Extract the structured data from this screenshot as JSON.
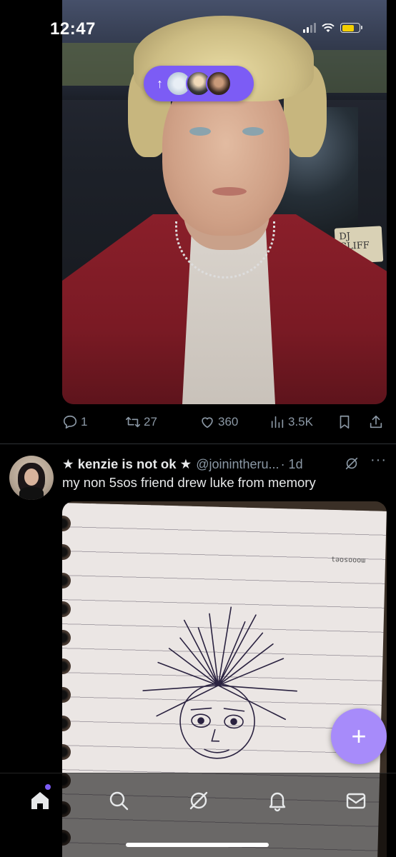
{
  "status_bar": {
    "time": "12:47"
  },
  "new_posts_pill": {
    "arrow": "↑",
    "avatars": [
      "avatar-1",
      "avatar-2",
      "avatar-3"
    ]
  },
  "post1": {
    "image_sign_text": "DJ CLIFF",
    "actions": {
      "replies": "1",
      "reposts": "27",
      "likes": "360",
      "views": "3.5K"
    }
  },
  "post2": {
    "author": "★ kenzie is not ok ★",
    "handle": "@joinintheru...",
    "time": "· 1d",
    "text": "my non 5sos friend drew luke from memory",
    "more": "···"
  },
  "fab": {
    "label": "+"
  },
  "bottom_nav": [
    "home-icon",
    "search-icon",
    "grok-icon",
    "notifications-icon",
    "messages-icon"
  ],
  "colors": {
    "accent": "#7c5cf5",
    "fab": "#a78bfa",
    "muted": "#8b98a5",
    "text": "#e7e9ea"
  }
}
